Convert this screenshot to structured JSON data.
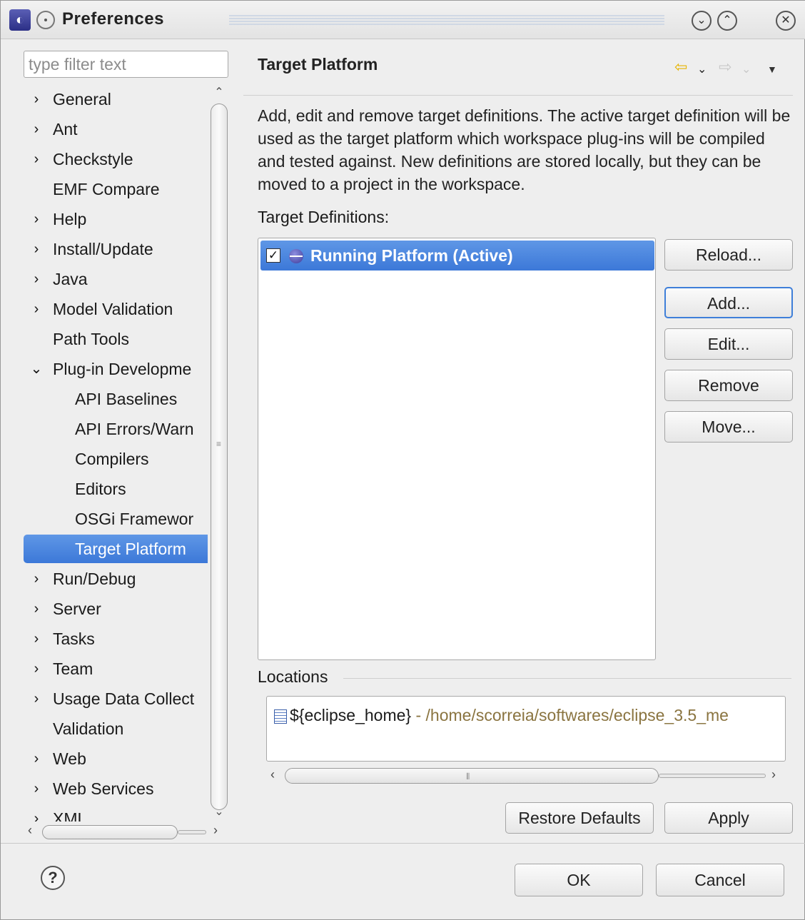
{
  "window": {
    "title": "Preferences",
    "app_icon": "eclipse-icon",
    "pin_icon": "pin-icon",
    "minimize_glyph": "⌄",
    "maximize_glyph": "⌃",
    "close_glyph": "✕"
  },
  "filter": {
    "placeholder": "type filter text"
  },
  "tree": {
    "items": [
      {
        "label": "General",
        "arrow": "›",
        "indent": 0
      },
      {
        "label": "Ant",
        "arrow": "›",
        "indent": 0
      },
      {
        "label": "Checkstyle",
        "arrow": "›",
        "indent": 0
      },
      {
        "label": "EMF Compare",
        "arrow": "",
        "indent": 0
      },
      {
        "label": "Help",
        "arrow": "›",
        "indent": 0
      },
      {
        "label": "Install/Update",
        "arrow": "›",
        "indent": 0
      },
      {
        "label": "Java",
        "arrow": "›",
        "indent": 0
      },
      {
        "label": "Model Validation",
        "arrow": "›",
        "indent": 0
      },
      {
        "label": "Path Tools",
        "arrow": "",
        "indent": 0
      },
      {
        "label": "Plug-in Developme",
        "arrow": "⌄",
        "indent": 0
      },
      {
        "label": "API Baselines",
        "arrow": "",
        "indent": 1
      },
      {
        "label": "API Errors/Warn",
        "arrow": "",
        "indent": 1
      },
      {
        "label": "Compilers",
        "arrow": "",
        "indent": 1
      },
      {
        "label": "Editors",
        "arrow": "",
        "indent": 1
      },
      {
        "label": "OSGi Framewor",
        "arrow": "",
        "indent": 1
      },
      {
        "label": "Target Platform",
        "arrow": "",
        "indent": 1,
        "selected": true
      },
      {
        "label": "Run/Debug",
        "arrow": "›",
        "indent": 0
      },
      {
        "label": "Server",
        "arrow": "›",
        "indent": 0
      },
      {
        "label": "Tasks",
        "arrow": "›",
        "indent": 0
      },
      {
        "label": "Team",
        "arrow": "›",
        "indent": 0
      },
      {
        "label": "Usage Data Collect",
        "arrow": "›",
        "indent": 0
      },
      {
        "label": "Validation",
        "arrow": "",
        "indent": 0
      },
      {
        "label": "Web",
        "arrow": "›",
        "indent": 0
      },
      {
        "label": "Web Services",
        "arrow": "›",
        "indent": 0
      },
      {
        "label": "XML",
        "arrow": "›",
        "indent": 0
      }
    ]
  },
  "page": {
    "title": "Target Platform",
    "nav_back_glyph": "⇦",
    "nav_forward_glyph": "⇨",
    "nav_dropdown_glyph": "⌄",
    "menu_glyph": "▼",
    "description": "Add, edit and remove target definitions.  The active target definition will be used as the target platform which workspace plug-ins will be compiled and tested against.  New definitions are stored locally, but they can be moved to a project in the workspace.",
    "target_definitions_label": "Target Definitions:",
    "target_definitions": [
      {
        "name": "Running Platform (Active)",
        "checked": true
      }
    ],
    "buttons": {
      "reload": "Reload...",
      "add": "Add...",
      "edit": "Edit...",
      "remove": "Remove",
      "move": "Move..."
    },
    "locations_label": "Locations",
    "locations": [
      {
        "variable": "${eclipse_home}",
        "path": " - /home/scorreia/softwares/eclipse_3.5_me"
      }
    ],
    "restore_defaults": "Restore Defaults",
    "apply": "Apply"
  },
  "footer": {
    "help_glyph": "?",
    "ok": "OK",
    "cancel": "Cancel"
  },
  "colors": {
    "selection": "#3c78d8",
    "location_path": "#8a7440",
    "nav_back": "#e6b400"
  }
}
